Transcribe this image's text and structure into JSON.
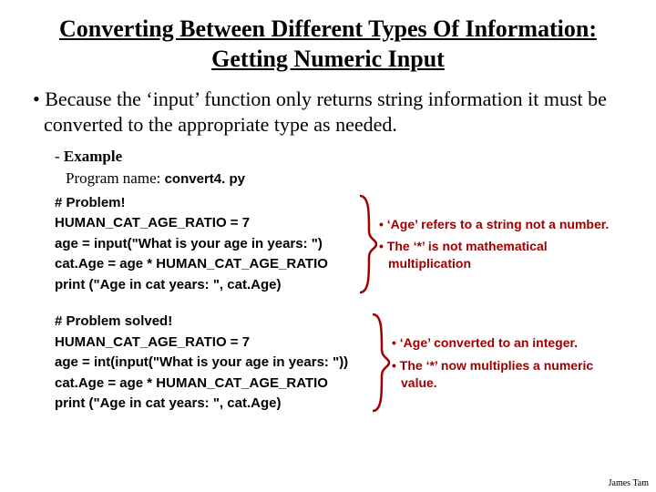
{
  "title": "Converting Between Different Types Of Information: Getting Numeric Input",
  "main_bullet": "Because the ‘input’ function only returns string information it must be converted to the appropriate type as needed.",
  "example_label": "Example",
  "program_label": "Program name: ",
  "program_name": "convert4. py",
  "problem": {
    "header": "# Problem!",
    "lines": [
      "HUMAN_CAT_AGE_RATIO = 7",
      "age = input(\"What is your age in years: \")",
      "cat.Age = age * HUMAN_CAT_AGE_RATIO",
      "print (\"Age in cat years: \", cat.Age)"
    ],
    "notes": [
      "‘Age’ refers to a string not a number.",
      "The ‘*’ is not mathematical multiplication"
    ]
  },
  "solved": {
    "header": "# Problem solved!",
    "lines": [
      "HUMAN_CAT_AGE_RATIO = 7",
      "age = int(input(\"What is your age in years: \"))",
      "cat.Age = age * HUMAN_CAT_AGE_RATIO",
      "print (\"Age in cat years: \", cat.Age)"
    ],
    "notes": [
      "‘Age’ converted to an integer.",
      "The ‘*’ now multiplies a numeric value."
    ]
  },
  "footer": "James Tam"
}
